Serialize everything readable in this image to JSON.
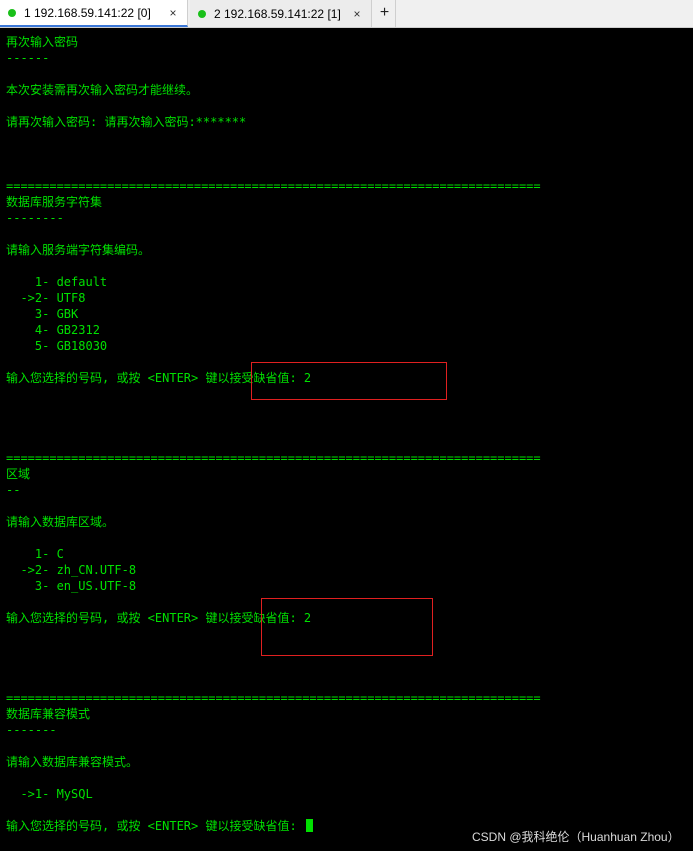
{
  "tabs": [
    {
      "label": "1 192.168.59.141:22 [0]",
      "status_color": "#19c019",
      "close": "×",
      "active": true
    },
    {
      "label": "2 192.168.59.141:22 [1]",
      "status_color": "#19c019",
      "close": "×",
      "active": false
    }
  ],
  "add_tab_label": "+",
  "terminal": {
    "text_color": "#00e000",
    "lines": [
      "再次输入密码",
      "------",
      "本次安装需再次输入密码才能继续。",
      "请再次输入密码: 请再次输入密码:*******",
      "==========================================================================",
      "数据库服务字符集",
      "--------",
      "请输入服务端字符集编码。",
      "    1- default",
      "  ->2- UTF8",
      "    3- GBK",
      "    4- GB2312",
      "    5- GB18030",
      "输入您选择的号码, 或按 <ENTER> 键以接受缺省值: 2",
      "==========================================================================",
      "区域",
      "--",
      "请输入数据库区域。",
      "    1- C",
      "  ->2- zh_CN.UTF-8",
      "    3- en_US.UTF-8",
      "输入您选择的号码, 或按 <ENTER> 键以接受缺省值: 2",
      "==========================================================================",
      "数据库兼容模式",
      "-------",
      "请输入数据库兼容模式。",
      "  ->1- MySQL",
      "输入您选择的号码, 或按 <ENTER> 键以接受缺省值: "
    ]
  },
  "highlight_color": "#e02020",
  "watermark": "CSDN @我科绝伦（Huanhuan Zhou）"
}
